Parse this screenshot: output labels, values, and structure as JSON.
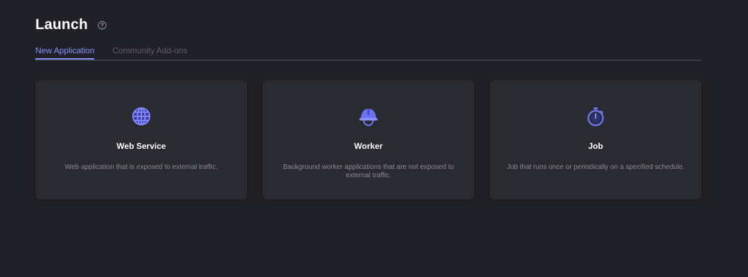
{
  "header": {
    "title": "Launch",
    "help_icon": "question-circle-icon"
  },
  "tabs": [
    {
      "label": "New Application",
      "active": true
    },
    {
      "label": "Community Add-ons",
      "active": false
    }
  ],
  "cards": [
    {
      "title": "Web Service",
      "description": "Web application that is exposed to external traffic.",
      "icon": "globe-icon"
    },
    {
      "title": "Worker",
      "description": "Background worker applications that are not exposed to external traffic.",
      "icon": "hard-hat-icon"
    },
    {
      "title": "Job",
      "description": "Job that runs once or periodically on a specified schedule.",
      "icon": "stopwatch-icon"
    }
  ],
  "colors": {
    "background": "#202126",
    "card": "#2a2b30",
    "accent": "#8b92ff",
    "icon": "#6b73f0",
    "muted_text": "#8a8b92"
  }
}
